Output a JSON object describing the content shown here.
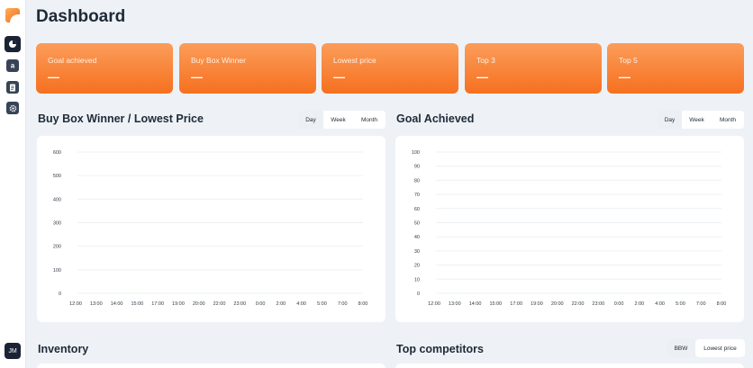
{
  "page": {
    "title": "Dashboard"
  },
  "sidebar": {
    "nav": [
      {
        "icon": "dashboard-icon",
        "active": true
      },
      {
        "icon": "amazon-icon",
        "active": false
      },
      {
        "icon": "document-icon",
        "active": false
      },
      {
        "icon": "gear-icon",
        "active": false
      }
    ],
    "avatar_initials": "JM"
  },
  "kpis": [
    {
      "label": "Goal achieved",
      "value": "—"
    },
    {
      "label": "Buy Box Winner",
      "value": "—"
    },
    {
      "label": "Lowest price",
      "value": "—"
    },
    {
      "label": "Top 3",
      "value": "—"
    },
    {
      "label": "Top 5",
      "value": "—"
    }
  ],
  "buybox_section": {
    "title": "Buy Box Winner / Lowest Price",
    "toggle": [
      "Day",
      "Week",
      "Month"
    ],
    "selected": "Day"
  },
  "goal_section": {
    "title": "Goal Achieved",
    "toggle": [
      "Day",
      "Week",
      "Month"
    ],
    "selected": "Day"
  },
  "inventory_section": {
    "title": "Inventory"
  },
  "competitors_section": {
    "title": "Top competitors",
    "toggle": [
      "BBW",
      "Lowest price"
    ],
    "selected": "BBW"
  },
  "chart_data": [
    {
      "type": "line",
      "title": "",
      "x": [
        "12:00",
        "13:00",
        "14:00",
        "15:00",
        "17:00",
        "19:00",
        "20:00",
        "22:00",
        "23:00",
        "0:00",
        "2:00",
        "4:00",
        "5:00",
        "7:00",
        "8:00"
      ],
      "yticks": [
        0,
        100,
        200,
        300,
        400,
        500,
        600
      ],
      "ylim": [
        0,
        600
      ],
      "series": [],
      "grid": true
    },
    {
      "type": "line",
      "title": "",
      "x": [
        "12:00",
        "13:00",
        "14:00",
        "15:00",
        "17:00",
        "19:00",
        "20:00",
        "22:00",
        "23:00",
        "0:00",
        "2:00",
        "4:00",
        "5:00",
        "7:00",
        "8:00"
      ],
      "yticks": [
        0,
        10,
        20,
        30,
        40,
        50,
        60,
        70,
        80,
        90,
        100
      ],
      "ylim": [
        0,
        100
      ],
      "series": [],
      "grid": true
    }
  ],
  "colors": {
    "accent": "#f6701f",
    "accent_light": "#fb9d5a",
    "background": "#eef2f7",
    "sidebar_active": "#1b2435"
  }
}
